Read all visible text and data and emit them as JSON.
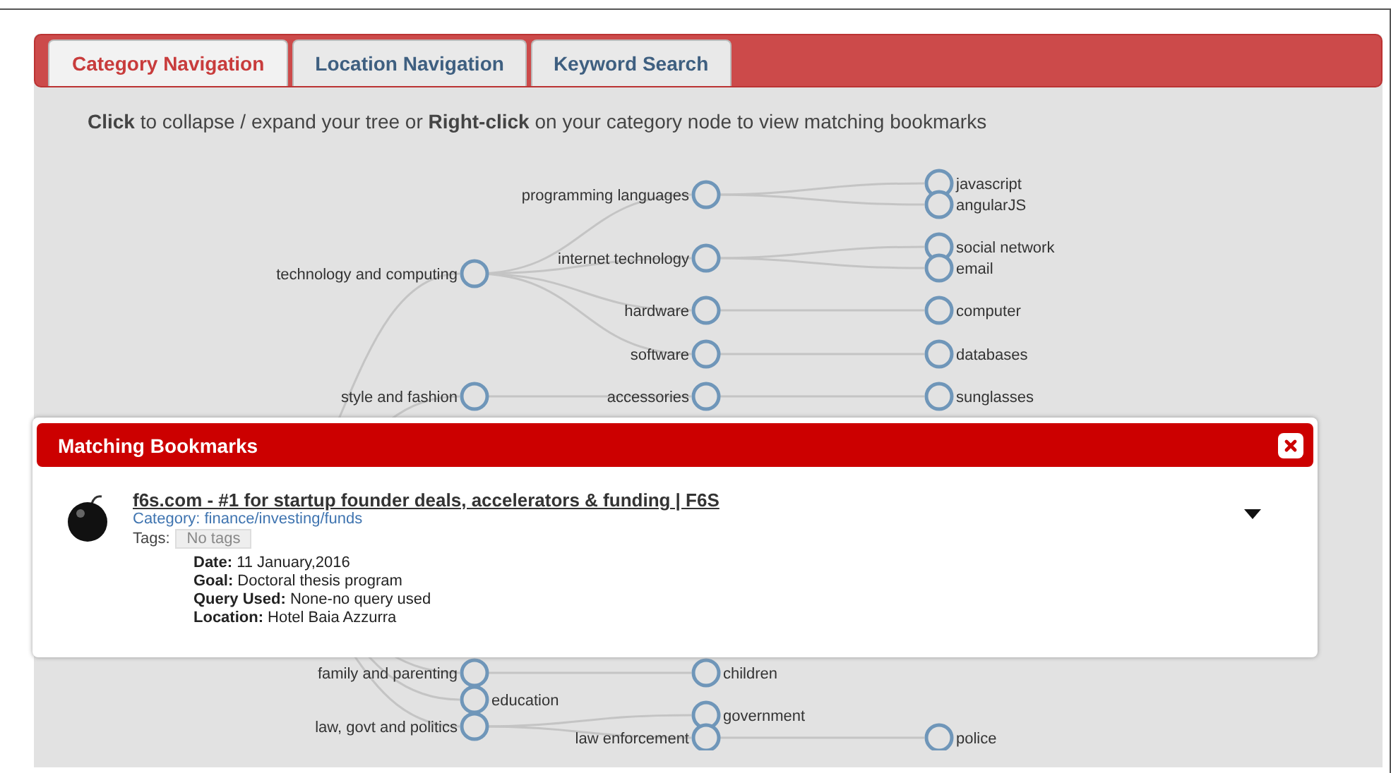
{
  "tabs": [
    {
      "label": "Category Navigation",
      "selected": true
    },
    {
      "label": "Location Navigation",
      "selected": false
    },
    {
      "label": "Keyword Search",
      "selected": false
    }
  ],
  "instruction": "**Click** to collapse / expand your tree or **Right-click** on your category node to view matching bookmarks",
  "tree": {
    "children": [
      {
        "name": "technology and computing",
        "children": [
          {
            "name": "programming languages",
            "children": [
              {
                "name": "javascript"
              },
              {
                "name": "angularJS"
              }
            ]
          },
          {
            "name": "internet technology",
            "children": [
              {
                "name": "social network"
              },
              {
                "name": "email"
              }
            ]
          },
          {
            "name": "hardware",
            "children": [
              {
                "name": "computer"
              }
            ]
          },
          {
            "name": "software",
            "children": [
              {
                "name": "databases"
              }
            ]
          }
        ]
      },
      {
        "name": "style and fashion",
        "children": [
          {
            "name": "accessories",
            "children": [
              {
                "name": "sunglasses"
              }
            ]
          }
        ]
      },
      {
        "name": "family and parenting",
        "children": [
          {
            "name": "children"
          }
        ]
      },
      {
        "name": "education"
      },
      {
        "name": "law, govt and politics",
        "children": [
          {
            "name": "government"
          },
          {
            "name": "law enforcement",
            "children": [
              {
                "name": "police"
              }
            ]
          }
        ]
      }
    ]
  },
  "popup": {
    "title": "Matching Bookmarks",
    "bookmarks": [
      {
        "title": "f6s.com - #1 for startup founder deals, accelerators & funding | F6S",
        "category": "Category: finance/investing/funds",
        "tags_label": "Tags:",
        "tags": [
          "No tags"
        ],
        "details": [
          "**Date:** 11 January,2016",
          "**Goal:** Doctoral thesis program",
          "**Query Used:** None-no query used",
          "**Location:** Hotel Baia Azzurra"
        ]
      }
    ]
  }
}
